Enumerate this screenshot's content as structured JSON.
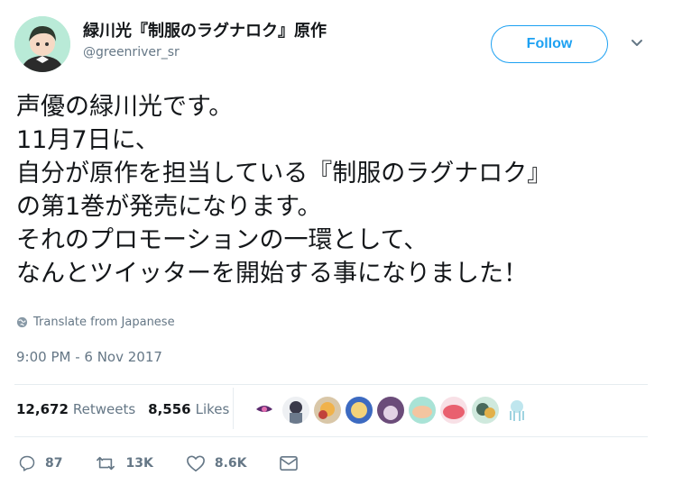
{
  "user": {
    "display_name": "緑川光『制服のラグナロク』原作",
    "handle": "@greenriver_sr"
  },
  "follow_label": "Follow",
  "tweet": {
    "text": "声優の緑川光です。\n11月7日に、\n自分が原作を担当している『制服のラグナロク』\nの第1巻が発売になります。\nそれのプロモーションの一環として、\nなんとツイッターを開始する事になりました！",
    "translate_label": "Translate from Japanese",
    "timestamp": "9:00 PM - 6 Nov 2017"
  },
  "stats": {
    "retweets_count": "12,672",
    "retweets_label": "Retweets",
    "likes_count": "8,556",
    "likes_label": "Likes"
  },
  "actions": {
    "replies": "87",
    "retweets": "13K",
    "likes": "8.6K"
  },
  "icons": {
    "caret": "chevron-down-icon",
    "translate": "globe-icon",
    "reply": "reply-icon",
    "retweet": "retweet-icon",
    "like": "heart-icon",
    "dm": "envelope-icon"
  },
  "colors": {
    "accent": "#1da1f2",
    "secondary_text": "#657786",
    "divider": "#e6ecf0"
  }
}
